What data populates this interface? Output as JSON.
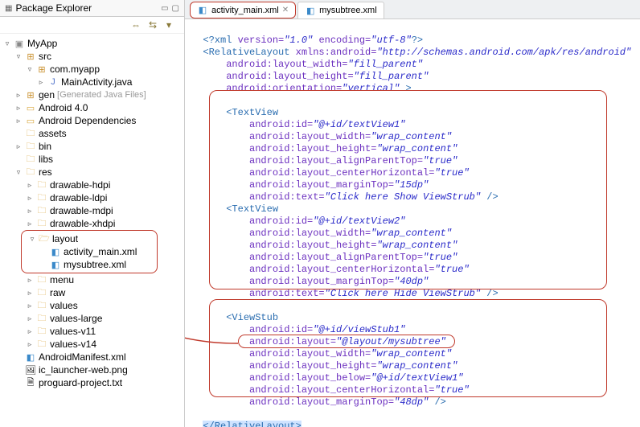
{
  "sidebar": {
    "title": "Package Explorer",
    "toolbar": [
      "back-icon",
      "fwd-icon",
      "link-icon",
      "menu-icon"
    ],
    "tree": {
      "project": "MyApp",
      "src": "src",
      "package": "com.myapp",
      "javafile": "MainActivity.java",
      "gen": "gen",
      "genNote": "[Generated Java Files]",
      "android": "Android 4.0",
      "deps": "Android Dependencies",
      "assets": "assets",
      "bin": "bin",
      "libs": "libs",
      "res": "res",
      "dh": "drawable-hdpi",
      "dl": "drawable-ldpi",
      "dm": "drawable-mdpi",
      "dx": "drawable-xhdpi",
      "layout": "layout",
      "amx": "activity_main.xml",
      "msx": "mysubtree.xml",
      "menu": "menu",
      "raw": "raw",
      "values": "values",
      "vl": "values-large",
      "v11": "values-v11",
      "v14": "values-v14",
      "manifest": "AndroidManifest.xml",
      "icl": "ic_launcher-web.png",
      "pgt": "proguard-project.txt"
    }
  },
  "tabs": {
    "t1": "activity_main.xml",
    "t2": "mysubtree.xml"
  },
  "code": {
    "l1a": "<?xml ",
    "l1b": "version=",
    "l1c": "\"1.0\"",
    "l1d": " encoding=",
    "l1e": "\"utf-8\"",
    "l1f": "?>",
    "l2a": "<RelativeLayout ",
    "l2b": "xmlns:android=",
    "l2c": "\"http://schemas.android.com/apk/res/android\"",
    "l3a": "android:layout_width=",
    "l3b": "\"fill_parent\"",
    "l4a": "android:layout_height=",
    "l4b": "\"fill_parent\"",
    "l5a": "android:orientation=",
    "l5b": "\"vertical\"",
    "l5c": " >",
    "tv": "<TextView",
    "idattr": "android:id=",
    "id1": "\"@+id/textView1\"",
    "id2": "\"@+id/textView2\"",
    "lwattr": "android:layout_width=",
    "wrap": "\"wrap_content\"",
    "lhattr": "android:layout_height=",
    "aptattr": "android:layout_alignParentTop=",
    "true": "\"true\"",
    "chattr": "android:layout_centerHorizontal=",
    "mtattr": "android:layout_marginTop=",
    "mt15": "\"15dp\"",
    "mt40": "\"40dp\"",
    "mt48": "\"48dp\"",
    "txtattr": "android:text=",
    "txt1": "\"Click here Show ViewStrub\"",
    "txt2": "\"Click here Hide ViewStrub\"",
    "closeEnd": " />",
    "vs": "<ViewStub",
    "vsid": "\"@+id/viewStub1\"",
    "layattr": "android:layout=",
    "layval": "\"@layout/mysubtree\"",
    "belattr": "android:layout_below=",
    "belval": "\"@+id/textView1\"",
    "endRel": "</RelativeLayout>"
  }
}
